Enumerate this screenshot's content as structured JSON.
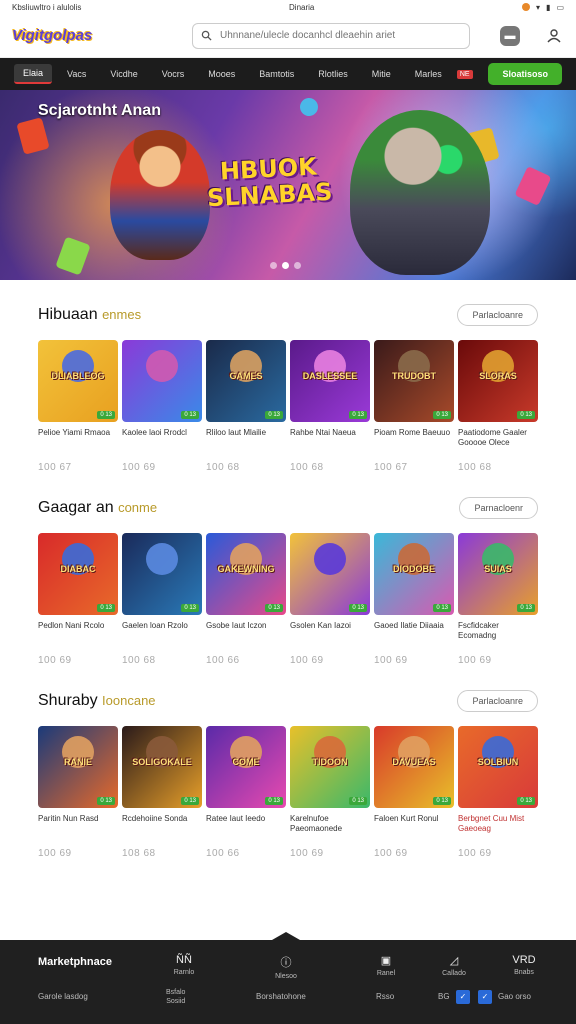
{
  "status_bar": {
    "left": "Kbsliuwltro  i  alulolis",
    "center": "Dinaria"
  },
  "header": {
    "logo_text": "Vigitgolpas",
    "search_placeholder": "Uhnnane/ulecle docanhcl dleaehin ariet",
    "message_icon": "message-icon",
    "user_icon": "user-icon"
  },
  "nav": {
    "items": [
      "Elaia",
      "Vacs",
      "Vicdhe",
      "Vocrs",
      "Mooes",
      "Bamtotis",
      "Rlotlies",
      "Mitie",
      "Marles"
    ],
    "badge": "NE",
    "cta": "Sloatisoso",
    "active_index": 0
  },
  "hero": {
    "title": "Scjarotnht Anan",
    "logo_line1": "HBUOK",
    "logo_line2": "SLNABAS",
    "slide_count": 3,
    "active_slide": 1
  },
  "sections": [
    {
      "title": "Hibuaan",
      "accent": "enmes",
      "button": "Parlacloanre",
      "cards": [
        {
          "thumb_text": "DLIABLEOG",
          "name": "Pelioe Yiami Rmaoa",
          "stat": "100 67",
          "badge": "0 13",
          "colors": [
            "#f2c23a",
            "#e8a020"
          ],
          "face": "#4a6ae0"
        },
        {
          "thumb_text": "",
          "name": "Kaolee laoi Rrodcl",
          "stat": "100 69",
          "badge": "0 13",
          "colors": [
            "#8a3ad8",
            "#3a8ae8"
          ],
          "face": "#d05ab0"
        },
        {
          "thumb_text": "GAMES",
          "name": "Rliloo laut Mlailie",
          "stat": "100 68",
          "badge": "0 13",
          "colors": [
            "#1a2a4a",
            "#2a6aa0"
          ],
          "face": "#d8a060"
        },
        {
          "thumb_text": "DASLESSEE",
          "name": "Rahbe Ntai Naeua",
          "stat": "100 68",
          "badge": "0 13",
          "colors": [
            "#5a1a8a",
            "#9a3ad8"
          ],
          "face": "#e880e0"
        },
        {
          "thumb_text": "TRUDOBT",
          "name": "Pioam Rome Baeuuo",
          "stat": "100 67",
          "badge": "0 13",
          "colors": [
            "#3a1a1a",
            "#a84a2a"
          ],
          "face": "#8a6a4a"
        },
        {
          "thumb_text": "SLORAS",
          "name": "Paatiodome Gaaler Gooooe Olece",
          "stat": "100 68",
          "badge": "0 13",
          "colors": [
            "#6a0a0a",
            "#c83a2a"
          ],
          "face": "#e0a030"
        }
      ]
    },
    {
      "title": "Gaagar an",
      "accent": "conme",
      "button": "Parnacloenr",
      "cards": [
        {
          "thumb_text": "DIABAC",
          "name": "Pedlon Nani Rcolo",
          "stat": "100 69",
          "badge": "0 13",
          "colors": [
            "#d82a2a",
            "#e86a2a"
          ],
          "face": "#3a6ad8"
        },
        {
          "thumb_text": "",
          "name": "Gaelen loan Rzolo",
          "stat": "100 68",
          "badge": "0 13",
          "colors": [
            "#1a2a5a",
            "#2a7ab8"
          ],
          "face": "#5a8ae0"
        },
        {
          "thumb_text": "GAKEWNING",
          "name": "Gsobe Iaut Iczon",
          "stat": "100 66",
          "badge": "0 13",
          "colors": [
            "#2a5ad8",
            "#e84a8a"
          ],
          "face": "#e0a060"
        },
        {
          "thumb_text": "",
          "name": "Gsolen Kan Iazoi",
          "stat": "100 69",
          "badge": "0 13",
          "colors": [
            "#f2c23a",
            "#8a3ad8"
          ],
          "face": "#5a3ad8"
        },
        {
          "thumb_text": "DIODOBE",
          "name": "Gaoed Ilatie Diiaaia",
          "stat": "100 69",
          "badge": "0 13",
          "colors": [
            "#3ab8d8",
            "#d85ab0"
          ],
          "face": "#c86a3a"
        },
        {
          "thumb_text": "SUIAS",
          "name": "Fscfidcaker Ecomadng",
          "stat": "100 69",
          "badge": "0 13",
          "colors": [
            "#8a3ad8",
            "#e8a02a"
          ],
          "face": "#3ab86a"
        }
      ]
    },
    {
      "title": "Shuraby",
      "accent": "Iooncane",
      "button": "Parlacloanre",
      "cards": [
        {
          "thumb_text": "RANIE",
          "name": "Paritin Nun Rasd",
          "stat": "100 69",
          "badge": "0 13",
          "colors": [
            "#1a3a7a",
            "#e86a2a"
          ],
          "face": "#e0a060"
        },
        {
          "thumb_text": "SOLIGOKALE",
          "name": "Rcdehoiine Sonda",
          "stat": "108 68",
          "badge": "0 13",
          "colors": [
            "#2a1a1a",
            "#e8a02a"
          ],
          "face": "#8a5a3a"
        },
        {
          "thumb_text": "COME",
          "name": "Ratee Iaut Ieedo",
          "stat": "100 66",
          "badge": "0 13",
          "colors": [
            "#5a2aa8",
            "#e84ab0"
          ],
          "face": "#e0a060"
        },
        {
          "thumb_text": "TIDOON",
          "name": "Karelnufoe Paeomaonede",
          "stat": "100 69",
          "badge": "0 13",
          "colors": [
            "#e8c02a",
            "#3ab86a"
          ],
          "face": "#d86a3a"
        },
        {
          "thumb_text": "DAVUEAS",
          "name": "Faloen Kurt Ronul",
          "stat": "100 69",
          "badge": "0 13",
          "colors": [
            "#d83a2a",
            "#e8c02a"
          ],
          "face": "#e0a060"
        },
        {
          "thumb_text": "SOLBIUN",
          "name": "Berbgnet Cuu Mist Gaeoeag",
          "stat": "100 69",
          "badge": "0 13",
          "colors": [
            "#e86a2a",
            "#d83a3a"
          ],
          "face": "#3a6ad8",
          "name_red": true
        }
      ]
    }
  ],
  "footer": {
    "brand": "Marketphnace",
    "cols": [
      {
        "icon": "grid-icon",
        "glyph": "ÑÑ",
        "label": "Rarnlo"
      },
      {
        "icon": "info-icon",
        "glyph": "ⓘ",
        "label": "Nlesoo"
      },
      {
        "icon": "cart-icon",
        "glyph": "▣",
        "label": "Ranel"
      },
      {
        "icon": "tag-icon",
        "glyph": "◿",
        "label": "Callado"
      },
      {
        "icon": "vr-icon",
        "glyph": "VRD",
        "label": "Bnabs"
      }
    ],
    "bottom_left": "Garole lasdog",
    "bottom_mid_1": "Bsfalo",
    "bottom_mid_2": "Sosiid",
    "bottom_center": "Borshatohone",
    "bottom_right_1": "Rsso",
    "bottom_right_2": "BG",
    "bottom_right_3": "Gao orso"
  },
  "colors": {
    "nav_bg": "#1c1c1c",
    "cta": "#43b02a",
    "footer_bg": "#202020",
    "accent_gold": "#b89a2a"
  }
}
